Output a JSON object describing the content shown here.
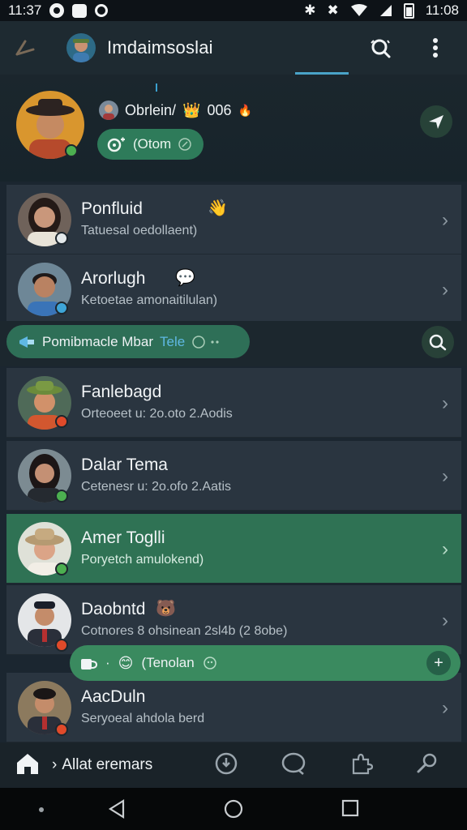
{
  "status_bar": {
    "time_left": "11:37",
    "time_right": "11:08"
  },
  "app_bar": {
    "title": "Imdaimsoslai"
  },
  "profile": {
    "name": "Obrlein/",
    "badge": "006",
    "status": "(Otom"
  },
  "chats": [
    {
      "name": "Ponfluid",
      "preview": "Tatuesal oedollaent)"
    },
    {
      "name": "Arorlugh",
      "preview": "Ketoetae amonaitilulan)"
    },
    {
      "name": "Fanlebagd",
      "preview": "Orteoeet u: 2o.oto 2.Aodis"
    },
    {
      "name": "Dalar Tema",
      "preview": "Cetenesr u: 2o.ofo 2.Aatis"
    },
    {
      "name": "Amer Toglli",
      "preview": "Poryetch amulokend)"
    },
    {
      "name": "Daobntd",
      "preview": "Cotnores 8 ohsinean 2sl4b (2 8obe)"
    },
    {
      "name": "AacDuln",
      "preview": "Seryoeal ahdola berd"
    }
  ],
  "community_banner": {
    "text": "Pomibmacle Mbar",
    "accent": "Tele"
  },
  "compose": {
    "text": "(Tenolan"
  },
  "bottom_nav": {
    "crumb": "Allat eremars"
  },
  "colors": {
    "background": "#1b2630",
    "accent_green": "#2f7254",
    "accent_blue": "#4aa3c8"
  }
}
